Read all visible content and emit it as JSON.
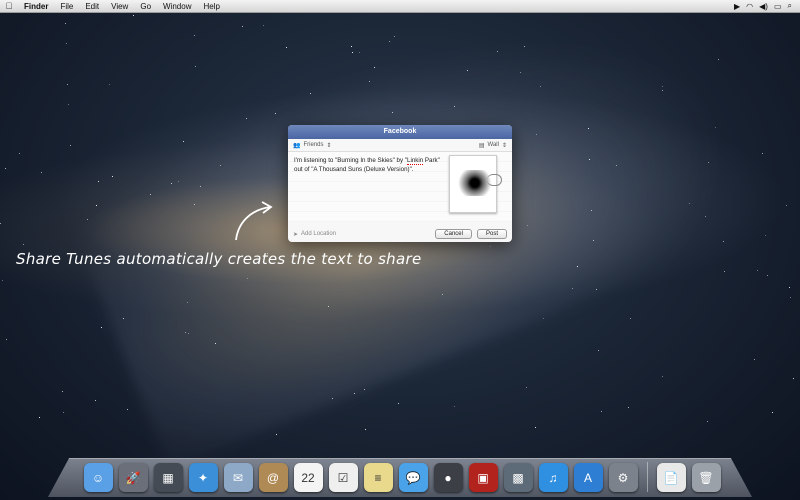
{
  "menubar": {
    "app": "Finder",
    "items": [
      "File",
      "Edit",
      "View",
      "Go",
      "Window",
      "Help"
    ]
  },
  "sheet": {
    "title": "Facebook",
    "audience": "Friends",
    "destination": "Wall",
    "message_parts": [
      "I'm listening to \"Burning In the Skies\" by \"",
      "Linkin",
      " Park\" out of \"A Thousand Suns (Deluxe Version)\"."
    ],
    "add_location": "Add Location",
    "cancel_label": "Cancel",
    "post_label": "Post"
  },
  "annotation": {
    "text": "Share Tunes automatically creates the text to share"
  },
  "dock": {
    "items": [
      {
        "name": "finder-icon",
        "color": "#5aa0e6",
        "glyph": "☺"
      },
      {
        "name": "launchpad-icon",
        "color": "#6a6f7a",
        "glyph": "🚀"
      },
      {
        "name": "mission-control-icon",
        "color": "#444b55",
        "glyph": "▦"
      },
      {
        "name": "safari-icon",
        "color": "#3b8fd9",
        "glyph": "✦"
      },
      {
        "name": "mail-icon",
        "color": "#8da9c7",
        "glyph": "✉"
      },
      {
        "name": "contacts-icon",
        "color": "#b08a54",
        "glyph": "@"
      },
      {
        "name": "calendar-icon",
        "color": "#f4f4f4",
        "glyph": "22"
      },
      {
        "name": "reminders-icon",
        "color": "#efefef",
        "glyph": "☑"
      },
      {
        "name": "notes-icon",
        "color": "#e9d98c",
        "glyph": "≡"
      },
      {
        "name": "messages-icon",
        "color": "#4aa3e8",
        "glyph": "💬"
      },
      {
        "name": "facetime-icon",
        "color": "#3c3f45",
        "glyph": "●"
      },
      {
        "name": "photo-booth-icon",
        "color": "#b2231e",
        "glyph": "▣"
      },
      {
        "name": "iphoto-icon",
        "color": "#5d6a78",
        "glyph": "▩"
      },
      {
        "name": "itunes-icon",
        "color": "#2f8fe0",
        "glyph": "♫"
      },
      {
        "name": "app-store-icon",
        "color": "#2e7fd3",
        "glyph": "A"
      },
      {
        "name": "system-preferences-icon",
        "color": "#7c828b",
        "glyph": "⚙"
      }
    ],
    "right_items": [
      {
        "name": "document-icon",
        "color": "#e8e8e8",
        "glyph": "📄"
      },
      {
        "name": "trash-icon",
        "color": "#9aa1a8",
        "glyph": "🗑"
      }
    ]
  }
}
